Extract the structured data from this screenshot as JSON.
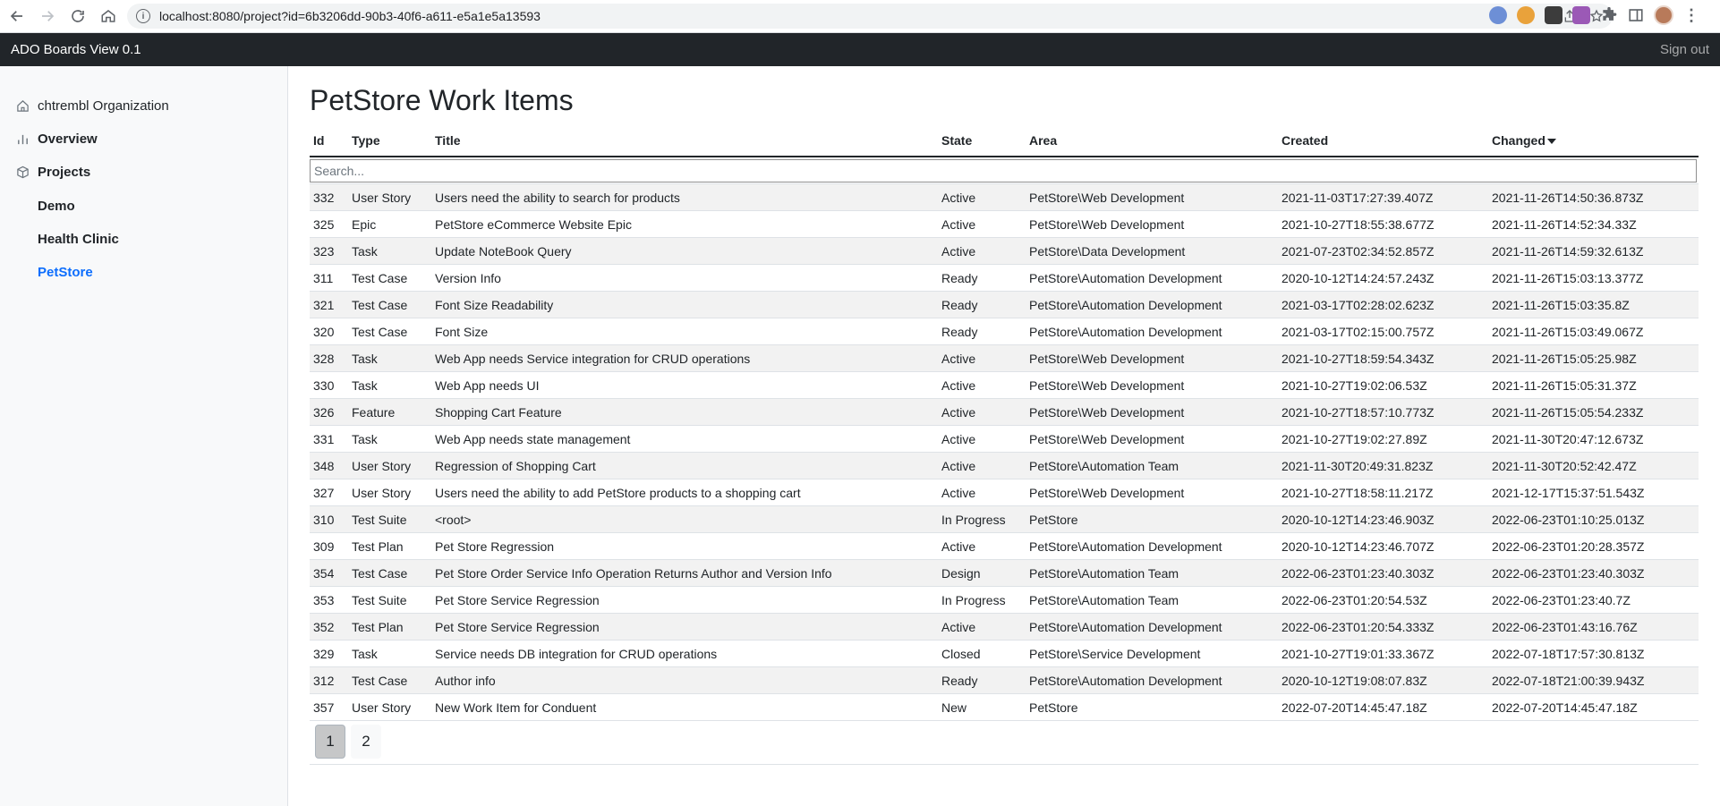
{
  "browser": {
    "url": "localhost:8080/project?id=6b3206dd-90b3-40f6-a611-e5a1e5a13593"
  },
  "appbar": {
    "brand": "ADO Boards View 0.1",
    "signout": "Sign out"
  },
  "sidebar": {
    "organization": "chtrembl Organization",
    "overview": "Overview",
    "projects": "Projects",
    "project_items": [
      "Demo",
      "Health Clinic",
      "PetStore"
    ],
    "active_project": "PetStore"
  },
  "page": {
    "title": "PetStore Work Items",
    "search_placeholder": "Search..."
  },
  "table": {
    "headers": {
      "id": "Id",
      "type": "Type",
      "title": "Title",
      "state": "State",
      "area": "Area",
      "created": "Created",
      "changed": "Changed"
    },
    "sorted_column": "Changed",
    "sort_direction": "descending",
    "rows": [
      {
        "id": "332",
        "type": "User Story",
        "title": "Users need the ability to search for products",
        "state": "Active",
        "area": "PetStore\\Web Development",
        "created": "2021-11-03T17:27:39.407Z",
        "changed": "2021-11-26T14:50:36.873Z"
      },
      {
        "id": "325",
        "type": "Epic",
        "title": "PetStore eCommerce Website Epic",
        "state": "Active",
        "area": "PetStore\\Web Development",
        "created": "2021-10-27T18:55:38.677Z",
        "changed": "2021-11-26T14:52:34.33Z"
      },
      {
        "id": "323",
        "type": "Task",
        "title": "Update NoteBook Query",
        "state": "Active",
        "area": "PetStore\\Data Development",
        "created": "2021-07-23T02:34:52.857Z",
        "changed": "2021-11-26T14:59:32.613Z"
      },
      {
        "id": "311",
        "type": "Test Case",
        "title": "Version Info",
        "state": "Ready",
        "area": "PetStore\\Automation Development",
        "created": "2020-10-12T14:24:57.243Z",
        "changed": "2021-11-26T15:03:13.377Z"
      },
      {
        "id": "321",
        "type": "Test Case",
        "title": "Font Size Readability",
        "state": "Ready",
        "area": "PetStore\\Automation Development",
        "created": "2021-03-17T02:28:02.623Z",
        "changed": "2021-11-26T15:03:35.8Z"
      },
      {
        "id": "320",
        "type": "Test Case",
        "title": "Font Size",
        "state": "Ready",
        "area": "PetStore\\Automation Development",
        "created": "2021-03-17T02:15:00.757Z",
        "changed": "2021-11-26T15:03:49.067Z"
      },
      {
        "id": "328",
        "type": "Task",
        "title": "Web App needs Service integration for CRUD operations",
        "state": "Active",
        "area": "PetStore\\Web Development",
        "created": "2021-10-27T18:59:54.343Z",
        "changed": "2021-11-26T15:05:25.98Z"
      },
      {
        "id": "330",
        "type": "Task",
        "title": "Web App needs UI",
        "state": "Active",
        "area": "PetStore\\Web Development",
        "created": "2021-10-27T19:02:06.53Z",
        "changed": "2021-11-26T15:05:31.37Z"
      },
      {
        "id": "326",
        "type": "Feature",
        "title": "Shopping Cart Feature",
        "state": "Active",
        "area": "PetStore\\Web Development",
        "created": "2021-10-27T18:57:10.773Z",
        "changed": "2021-11-26T15:05:54.233Z"
      },
      {
        "id": "331",
        "type": "Task",
        "title": "Web App needs state management",
        "state": "Active",
        "area": "PetStore\\Web Development",
        "created": "2021-10-27T19:02:27.89Z",
        "changed": "2021-11-30T20:47:12.673Z"
      },
      {
        "id": "348",
        "type": "User Story",
        "title": "Regression of Shopping Cart",
        "state": "Active",
        "area": "PetStore\\Automation Team",
        "created": "2021-11-30T20:49:31.823Z",
        "changed": "2021-11-30T20:52:42.47Z"
      },
      {
        "id": "327",
        "type": "User Story",
        "title": "Users need the ability to add PetStore products to a shopping cart",
        "state": "Active",
        "area": "PetStore\\Web Development",
        "created": "2021-10-27T18:58:11.217Z",
        "changed": "2021-12-17T15:37:51.543Z"
      },
      {
        "id": "310",
        "type": "Test Suite",
        "title": "<root>",
        "state": "In Progress",
        "area": "PetStore",
        "created": "2020-10-12T14:23:46.903Z",
        "changed": "2022-06-23T01:10:25.013Z"
      },
      {
        "id": "309",
        "type": "Test Plan",
        "title": "Pet Store Regression",
        "state": "Active",
        "area": "PetStore\\Automation Development",
        "created": "2020-10-12T14:23:46.707Z",
        "changed": "2022-06-23T01:20:28.357Z"
      },
      {
        "id": "354",
        "type": "Test Case",
        "title": "Pet Store Order Service Info Operation Returns Author and Version Info",
        "state": "Design",
        "area": "PetStore\\Automation Team",
        "created": "2022-06-23T01:23:40.303Z",
        "changed": "2022-06-23T01:23:40.303Z"
      },
      {
        "id": "353",
        "type": "Test Suite",
        "title": "Pet Store Service Regression",
        "state": "In Progress",
        "area": "PetStore\\Automation Team",
        "created": "2022-06-23T01:20:54.53Z",
        "changed": "2022-06-23T01:23:40.7Z"
      },
      {
        "id": "352",
        "type": "Test Plan",
        "title": "Pet Store Service Regression",
        "state": "Active",
        "area": "PetStore\\Automation Development",
        "created": "2022-06-23T01:20:54.333Z",
        "changed": "2022-06-23T01:43:16.76Z"
      },
      {
        "id": "329",
        "type": "Task",
        "title": "Service needs DB integration for CRUD operations",
        "state": "Closed",
        "area": "PetStore\\Service Development",
        "created": "2021-10-27T19:01:33.367Z",
        "changed": "2022-07-18T17:57:30.813Z"
      },
      {
        "id": "312",
        "type": "Test Case",
        "title": "Author info",
        "state": "Ready",
        "area": "PetStore\\Automation Development",
        "created": "2020-10-12T19:08:07.83Z",
        "changed": "2022-07-18T21:00:39.943Z"
      },
      {
        "id": "357",
        "type": "User Story",
        "title": "New Work Item for Conduent",
        "state": "New",
        "area": "PetStore",
        "created": "2022-07-20T14:45:47.18Z",
        "changed": "2022-07-20T14:45:47.18Z"
      }
    ]
  },
  "pagination": {
    "pages": [
      "1",
      "2"
    ],
    "current": "1"
  },
  "icons": {
    "back": "arrow-left-icon",
    "forward": "arrow-right-icon",
    "reload": "reload-icon",
    "home": "home-icon",
    "site_info": "info-icon",
    "share": "share-icon",
    "bookmark": "star-icon",
    "extensions": "puzzle-icon",
    "side_panel": "side-panel-icon",
    "menu": "kebab-menu-icon",
    "org": "house-icon",
    "overview": "bar-chart-icon",
    "projects": "box-icon"
  },
  "colors": {
    "appbar_bg": "#212529",
    "active_link": "#0d6efd",
    "striped_row": "#f2f2f2"
  }
}
